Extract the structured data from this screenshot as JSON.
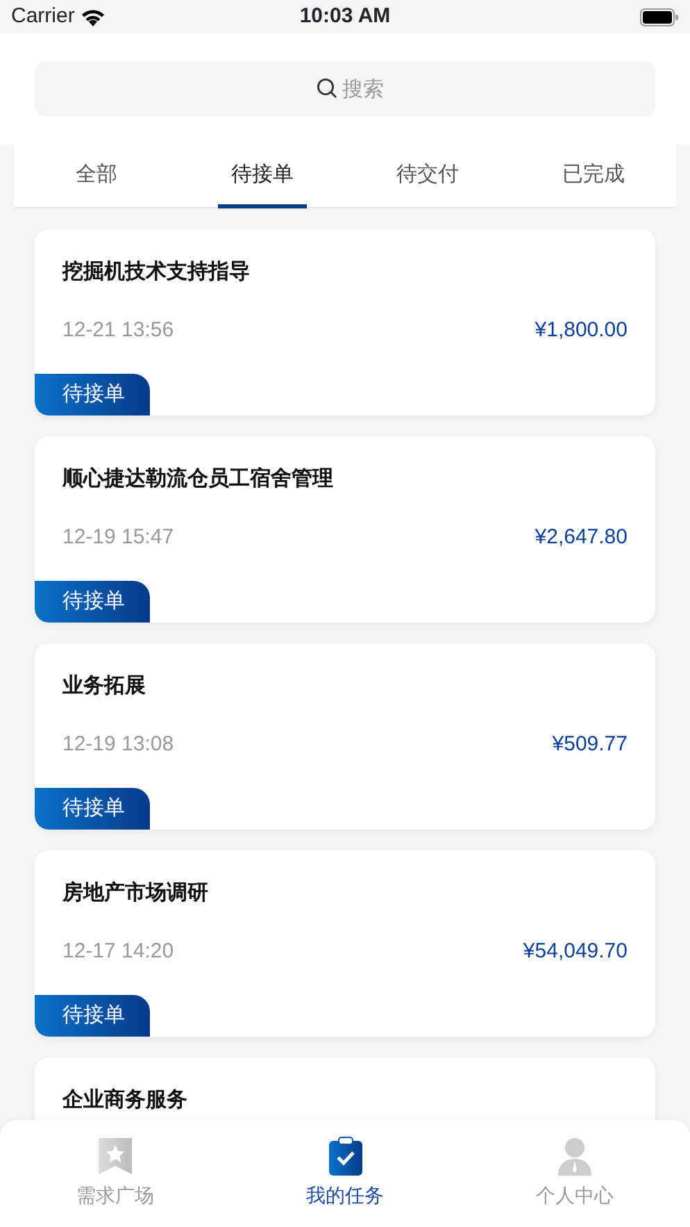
{
  "status_bar": {
    "carrier": "Carrier",
    "time": "10:03 AM"
  },
  "search": {
    "placeholder": "搜索"
  },
  "tabs": [
    {
      "label": "全部",
      "selected": false
    },
    {
      "label": "待接单",
      "selected": true
    },
    {
      "label": "待交付",
      "selected": false
    },
    {
      "label": "已完成",
      "selected": false
    }
  ],
  "tasks": [
    {
      "title": "挖掘机技术支持指导",
      "time": "12-21 13:56",
      "price": "¥1,800.00",
      "status": "待接单"
    },
    {
      "title": "顺心捷达勒流仓员工宿舍管理",
      "time": "12-19 15:47",
      "price": "¥2,647.80",
      "status": "待接单"
    },
    {
      "title": "业务拓展",
      "time": "12-19 13:08",
      "price": "¥509.77",
      "status": "待接单"
    },
    {
      "title": "房地产市场调研",
      "time": "12-17 14:20",
      "price": "¥54,049.70",
      "status": "待接单"
    },
    {
      "title": "企业商务服务"
    }
  ],
  "tab_bar": [
    {
      "label": "需求广场",
      "kind": "star",
      "selected": false
    },
    {
      "label": "我的任务",
      "kind": "task",
      "selected": true
    },
    {
      "label": "个人中心",
      "kind": "person",
      "selected": false
    }
  ]
}
